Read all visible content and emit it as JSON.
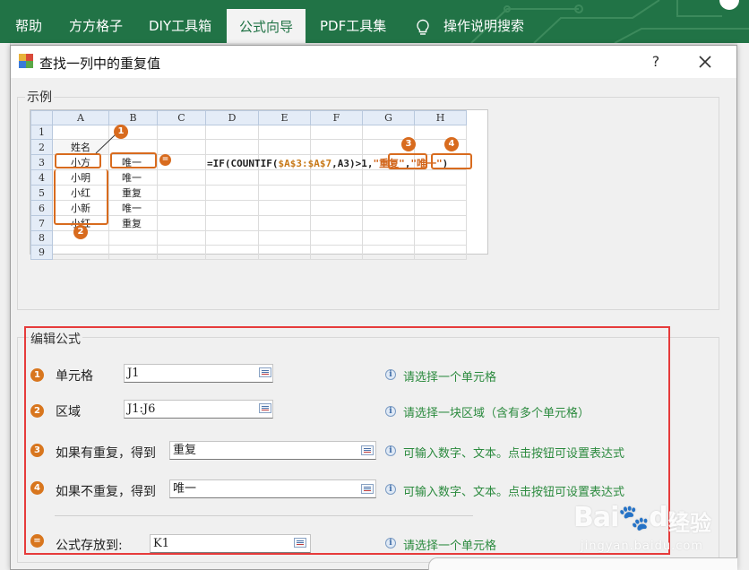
{
  "ribbon": {
    "tabs": [
      "帮助",
      "方方格子",
      "DIY工具箱",
      "公式向导",
      "PDF工具集",
      "操作说明搜索"
    ],
    "active_tab": "公式向导",
    "color": "#217346"
  },
  "dialog": {
    "title": "查找一列中的重复值",
    "help_label": "?",
    "close_icon": "close-icon"
  },
  "example": {
    "group_label": "示例",
    "col_headers": [
      "A",
      "B",
      "C",
      "D",
      "E",
      "F",
      "G",
      "H"
    ],
    "row_numbers": [
      "1",
      "2",
      "3",
      "4",
      "5",
      "6",
      "7",
      "8",
      "9"
    ],
    "header_cell": "姓名",
    "names": [
      "小方",
      "小明",
      "小红",
      "小新",
      "小红"
    ],
    "results": [
      "唯一",
      "唯一",
      "重复",
      "唯一",
      "重复"
    ],
    "formula": {
      "prefix": "=IF(COUNTIF(",
      "range": "$A$3:$A$7",
      "middle": ",A3)>1,",
      "dup_text": "\"重复\"",
      "comma": ",",
      "uniq_text": "\"唯一\"",
      "suffix": ")"
    },
    "badges": [
      "1",
      "2",
      "3",
      "4"
    ],
    "equals_badge": "=",
    "accent": "#d86b1e"
  },
  "edit": {
    "group_label": "编辑公式",
    "rows": [
      {
        "badge": "1",
        "label": "单元格",
        "value": "J1",
        "hint": "请选择一个单元格"
      },
      {
        "badge": "2",
        "label": "区域",
        "value": "J1:J6",
        "hint": "请选择一块区域（含有多个单元格）"
      },
      {
        "badge": "3",
        "label": "如果有重复，得到",
        "value": "重复",
        "hint": "可输入数字、文本。点击按钮可设置表达式"
      },
      {
        "badge": "4",
        "label": "如果不重复，得到",
        "value": "唯一",
        "hint": "可输入数字、文本。点击按钮可设置表达式"
      },
      {
        "badge": "=",
        "label": "公式存放到:",
        "value": "K1",
        "hint": "请选择一个单元格"
      }
    ],
    "highlight_color": "#e63b3b",
    "hint_color": "#2b8a3e"
  },
  "watermark": {
    "brand": "Bai",
    "brand2": "du",
    "cn": "经验",
    "url": "jingyan.baidu.com"
  }
}
